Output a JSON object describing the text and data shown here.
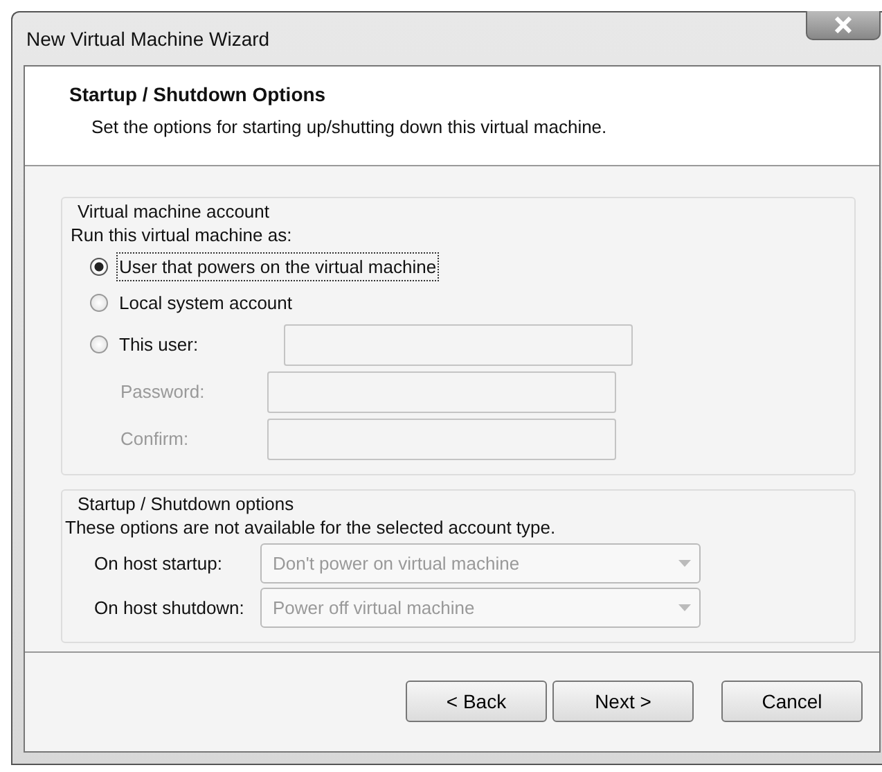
{
  "window": {
    "title": "New Virtual Machine Wizard"
  },
  "header": {
    "title": "Startup / Shutdown Options",
    "subtitle": "Set the options for starting up/shutting down this virtual machine."
  },
  "account_group": {
    "legend": "Virtual machine account",
    "prompt": "Run this virtual machine as:",
    "options": [
      {
        "label": "User that powers on the virtual machine",
        "selected": true,
        "focused": true,
        "kind": "plain"
      },
      {
        "label": "Local system account",
        "selected": false,
        "focused": false,
        "kind": "plain"
      },
      {
        "label": "This user:",
        "selected": false,
        "focused": false,
        "kind": "with-field",
        "field_disabled": true
      }
    ],
    "fields": [
      {
        "label": "Password:",
        "disabled": true
      },
      {
        "label": "Confirm:",
        "disabled": true
      }
    ]
  },
  "power_group": {
    "legend": "Startup / Shutdown options",
    "note": "These options are not available for the selected account type.",
    "selects": [
      {
        "label": "On host startup:",
        "value": "Don't power on virtual machine",
        "disabled": true
      },
      {
        "label": "On host shutdown:",
        "value": "Power off virtual machine",
        "disabled": true
      }
    ]
  },
  "buttons": [
    {
      "label": "< Back"
    },
    {
      "label": "Next >"
    },
    {
      "label": "Cancel"
    }
  ]
}
